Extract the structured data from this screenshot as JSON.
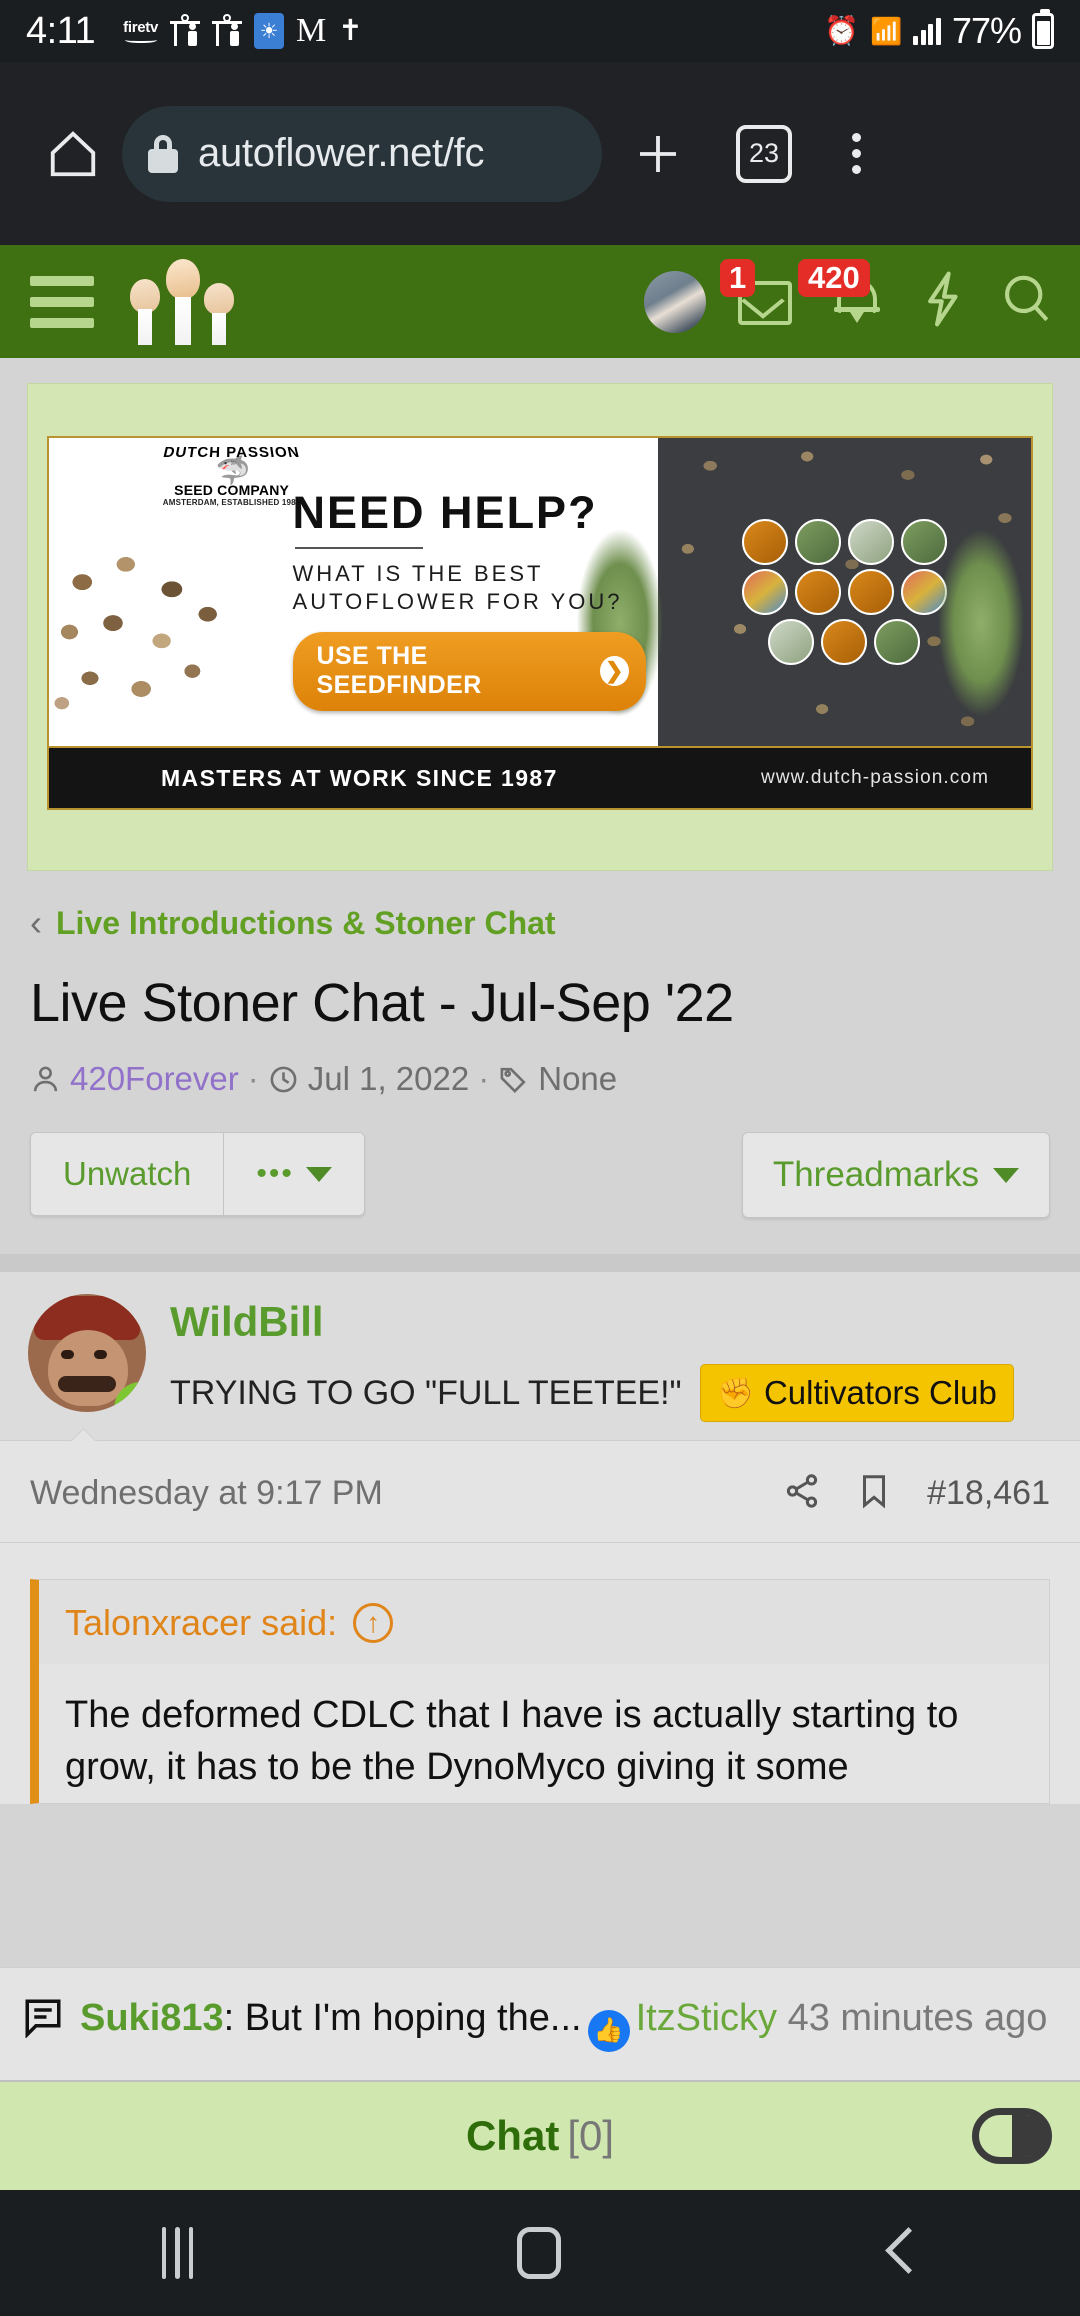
{
  "statusbar": {
    "time": "4:11",
    "firetv_label_1": "fire",
    "firetv_label_2": "tv",
    "battery_pct": "77%",
    "icons": [
      "firetv-icon",
      "person-cast-icon",
      "person-cast-icon",
      "app-blue-icon",
      "gmail-icon",
      "missed-call-icon",
      "alarm-icon",
      "wifi-icon",
      "signal-icon",
      "battery-icon"
    ]
  },
  "browser": {
    "home_icon": "home-icon",
    "lock_icon": "lock-icon",
    "url": "autoflower.net/fc",
    "new_tab_icon": "plus-icon",
    "tab_count": "23",
    "menu_icon": "three-dot-menu-icon"
  },
  "forum_header": {
    "menu_icon": "hamburger-menu-icon",
    "logo_name": "autoflower-logo",
    "avatar": "user-avatar",
    "inbox_icon": "envelope-icon",
    "inbox_count": "1",
    "alerts_icon": "bell-icon",
    "alerts_count": "420",
    "bolt_icon": "lightning-bolt-icon",
    "search_icon": "search-icon"
  },
  "ad": {
    "brand_name": "DUTCH PASSION",
    "brand_reg": "®",
    "brand_sub": "SEED COMPANY",
    "brand_est": "AMSTERDAM, ESTABLISHED 1987",
    "headline": "NEED HELP?",
    "question_line1": "WHAT IS THE BEST",
    "question_line2": "AUTOFLOWER FOR YOU?",
    "cta": "USE THE SEEDFINDER",
    "cta_arrow": "❯",
    "footer_left": "MASTERS AT WORK SINCE 1987",
    "footer_right": "www.dutch-passion.com"
  },
  "breadcrumb": {
    "back_icon": "chevron-left-icon",
    "label": "Live Introductions & Stoner Chat"
  },
  "thread": {
    "title": "Live Stoner Chat - Jul-Sep '22",
    "author": "420Forever",
    "author_icon": "person-icon",
    "date": "Jul 1, 2022",
    "date_icon": "clock-icon",
    "tags": "None",
    "tag_icon": "tag-icon",
    "sep": "·"
  },
  "actions": {
    "unwatch": "Unwatch",
    "more_dots": "•••",
    "threadmarks": "Threadmarks"
  },
  "post": {
    "username": "WildBill",
    "user_title": "TRYING TO GO \"FULL TEETEE!\"",
    "badge_label": "Cultivators Club",
    "badge_icon": "fist-icon",
    "badge_color": "#f5c400",
    "online_icon": "online-status-icon",
    "date": "Wednesday at 9:17 PM",
    "share_icon": "share-icon",
    "bookmark_icon": "bookmark-icon",
    "post_number": "#18,461",
    "quote": {
      "author": "Talonxracer",
      "said_suffix": " said:",
      "jump_icon": "jump-to-quote-icon",
      "text": "The deformed CDLC that I have is actually starting to grow, it has to be the DynoMyco giving it some"
    }
  },
  "chat_notify": {
    "icon": "chat-bubble-icon",
    "user": "Suki813",
    "message": ": But I'm hoping the...",
    "reaction_icon": "like-icon",
    "reactor": "ItzSticky",
    "time": "43 minutes ago"
  },
  "chat_bar": {
    "label": "Chat",
    "count": "[0]",
    "toggle_icon": "toggle-switch-icon"
  },
  "navbar": {
    "recents_icon": "recents-icon",
    "home_icon": "home-nav-icon",
    "back_icon": "back-nav-icon"
  },
  "colors": {
    "header_green": "#3f7012",
    "link_green": "#5a9b2e",
    "badge_red": "#e52d27",
    "quote_orange": "#e09016",
    "club_yellow": "#f5c400"
  }
}
